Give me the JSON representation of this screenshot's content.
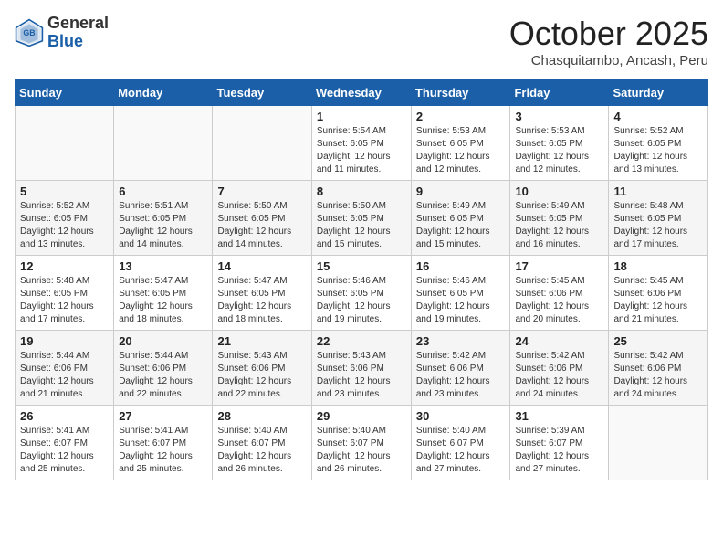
{
  "header": {
    "logo": {
      "line1": "General",
      "line2": "Blue"
    },
    "month": "October 2025",
    "location": "Chasquitambo, Ancash, Peru"
  },
  "weekdays": [
    "Sunday",
    "Monday",
    "Tuesday",
    "Wednesday",
    "Thursday",
    "Friday",
    "Saturday"
  ],
  "weeks": [
    [
      {
        "day": "",
        "detail": ""
      },
      {
        "day": "",
        "detail": ""
      },
      {
        "day": "",
        "detail": ""
      },
      {
        "day": "1",
        "detail": "Sunrise: 5:54 AM\nSunset: 6:05 PM\nDaylight: 12 hours\nand 11 minutes."
      },
      {
        "day": "2",
        "detail": "Sunrise: 5:53 AM\nSunset: 6:05 PM\nDaylight: 12 hours\nand 12 minutes."
      },
      {
        "day": "3",
        "detail": "Sunrise: 5:53 AM\nSunset: 6:05 PM\nDaylight: 12 hours\nand 12 minutes."
      },
      {
        "day": "4",
        "detail": "Sunrise: 5:52 AM\nSunset: 6:05 PM\nDaylight: 12 hours\nand 13 minutes."
      }
    ],
    [
      {
        "day": "5",
        "detail": "Sunrise: 5:52 AM\nSunset: 6:05 PM\nDaylight: 12 hours\nand 13 minutes."
      },
      {
        "day": "6",
        "detail": "Sunrise: 5:51 AM\nSunset: 6:05 PM\nDaylight: 12 hours\nand 14 minutes."
      },
      {
        "day": "7",
        "detail": "Sunrise: 5:50 AM\nSunset: 6:05 PM\nDaylight: 12 hours\nand 14 minutes."
      },
      {
        "day": "8",
        "detail": "Sunrise: 5:50 AM\nSunset: 6:05 PM\nDaylight: 12 hours\nand 15 minutes."
      },
      {
        "day": "9",
        "detail": "Sunrise: 5:49 AM\nSunset: 6:05 PM\nDaylight: 12 hours\nand 15 minutes."
      },
      {
        "day": "10",
        "detail": "Sunrise: 5:49 AM\nSunset: 6:05 PM\nDaylight: 12 hours\nand 16 minutes."
      },
      {
        "day": "11",
        "detail": "Sunrise: 5:48 AM\nSunset: 6:05 PM\nDaylight: 12 hours\nand 17 minutes."
      }
    ],
    [
      {
        "day": "12",
        "detail": "Sunrise: 5:48 AM\nSunset: 6:05 PM\nDaylight: 12 hours\nand 17 minutes."
      },
      {
        "day": "13",
        "detail": "Sunrise: 5:47 AM\nSunset: 6:05 PM\nDaylight: 12 hours\nand 18 minutes."
      },
      {
        "day": "14",
        "detail": "Sunrise: 5:47 AM\nSunset: 6:05 PM\nDaylight: 12 hours\nand 18 minutes."
      },
      {
        "day": "15",
        "detail": "Sunrise: 5:46 AM\nSunset: 6:05 PM\nDaylight: 12 hours\nand 19 minutes."
      },
      {
        "day": "16",
        "detail": "Sunrise: 5:46 AM\nSunset: 6:05 PM\nDaylight: 12 hours\nand 19 minutes."
      },
      {
        "day": "17",
        "detail": "Sunrise: 5:45 AM\nSunset: 6:06 PM\nDaylight: 12 hours\nand 20 minutes."
      },
      {
        "day": "18",
        "detail": "Sunrise: 5:45 AM\nSunset: 6:06 PM\nDaylight: 12 hours\nand 21 minutes."
      }
    ],
    [
      {
        "day": "19",
        "detail": "Sunrise: 5:44 AM\nSunset: 6:06 PM\nDaylight: 12 hours\nand 21 minutes."
      },
      {
        "day": "20",
        "detail": "Sunrise: 5:44 AM\nSunset: 6:06 PM\nDaylight: 12 hours\nand 22 minutes."
      },
      {
        "day": "21",
        "detail": "Sunrise: 5:43 AM\nSunset: 6:06 PM\nDaylight: 12 hours\nand 22 minutes."
      },
      {
        "day": "22",
        "detail": "Sunrise: 5:43 AM\nSunset: 6:06 PM\nDaylight: 12 hours\nand 23 minutes."
      },
      {
        "day": "23",
        "detail": "Sunrise: 5:42 AM\nSunset: 6:06 PM\nDaylight: 12 hours\nand 23 minutes."
      },
      {
        "day": "24",
        "detail": "Sunrise: 5:42 AM\nSunset: 6:06 PM\nDaylight: 12 hours\nand 24 minutes."
      },
      {
        "day": "25",
        "detail": "Sunrise: 5:42 AM\nSunset: 6:06 PM\nDaylight: 12 hours\nand 24 minutes."
      }
    ],
    [
      {
        "day": "26",
        "detail": "Sunrise: 5:41 AM\nSunset: 6:07 PM\nDaylight: 12 hours\nand 25 minutes."
      },
      {
        "day": "27",
        "detail": "Sunrise: 5:41 AM\nSunset: 6:07 PM\nDaylight: 12 hours\nand 25 minutes."
      },
      {
        "day": "28",
        "detail": "Sunrise: 5:40 AM\nSunset: 6:07 PM\nDaylight: 12 hours\nand 26 minutes."
      },
      {
        "day": "29",
        "detail": "Sunrise: 5:40 AM\nSunset: 6:07 PM\nDaylight: 12 hours\nand 26 minutes."
      },
      {
        "day": "30",
        "detail": "Sunrise: 5:40 AM\nSunset: 6:07 PM\nDaylight: 12 hours\nand 27 minutes."
      },
      {
        "day": "31",
        "detail": "Sunrise: 5:39 AM\nSunset: 6:07 PM\nDaylight: 12 hours\nand 27 minutes."
      },
      {
        "day": "",
        "detail": ""
      }
    ]
  ]
}
